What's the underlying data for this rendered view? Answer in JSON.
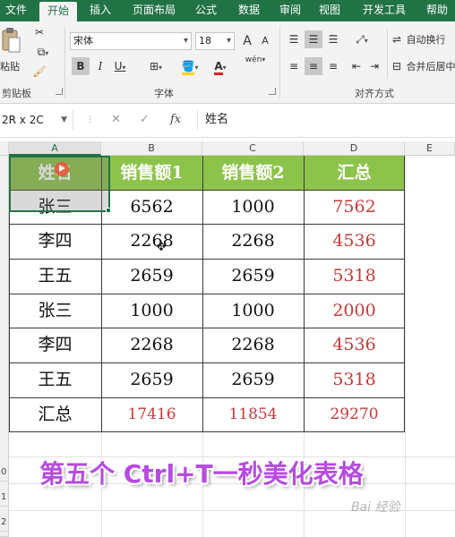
{
  "ribbon": {
    "tabs": [
      "文件",
      "开始",
      "插入",
      "页面布局",
      "公式",
      "数据",
      "审阅",
      "视图",
      "开发工具",
      "帮助"
    ],
    "active_tab": "开始",
    "clipboard": {
      "paste_label": "粘贴",
      "group_label": "剪贴板"
    },
    "font": {
      "name": "宋体",
      "size": "18",
      "group_label": "字体",
      "bold": "B",
      "italic": "I",
      "underline": "U",
      "grow": "A",
      "shrink": "A",
      "font_color_glyph": "A",
      "wen_glyph": "wén"
    },
    "alignment": {
      "wrap_text_label": "自动换行",
      "merge_center_label": "合并后居中",
      "group_label": "对齐方式"
    }
  },
  "formula_bar": {
    "name_box": "2R x 2C",
    "cancel_glyph": "✕",
    "enter_glyph": "✓",
    "fx_glyph": "fx",
    "content": "姓名"
  },
  "grid": {
    "columns": [
      "A",
      "B",
      "C",
      "D",
      "E"
    ],
    "selected_column": "A",
    "row_numbers_visible": [
      "0",
      "1",
      "2"
    ],
    "header": [
      "姓名",
      "销售额1",
      "销售额2",
      "汇总"
    ],
    "rows": [
      [
        "张三",
        "6562",
        "1000",
        "7562"
      ],
      [
        "李四",
        "2268",
        "2268",
        "4536"
      ],
      [
        "王五",
        "2659",
        "2659",
        "5318"
      ],
      [
        "张三",
        "1000",
        "1000",
        "2000"
      ],
      [
        "李四",
        "2268",
        "2268",
        "4536"
      ],
      [
        "王五",
        "2659",
        "2659",
        "5318"
      ]
    ],
    "total_row": [
      "汇总",
      "17416",
      "11854",
      "29270"
    ]
  },
  "overlay": {
    "caption": "第五个 Ctrl+T一秒美化表格",
    "watermark": "Bai 经验"
  },
  "colors": {
    "ribbon_green": "#217346",
    "header_fill": "#8cc34a",
    "total_red": "#c43a3a",
    "caption_purple": "#b64be0"
  }
}
